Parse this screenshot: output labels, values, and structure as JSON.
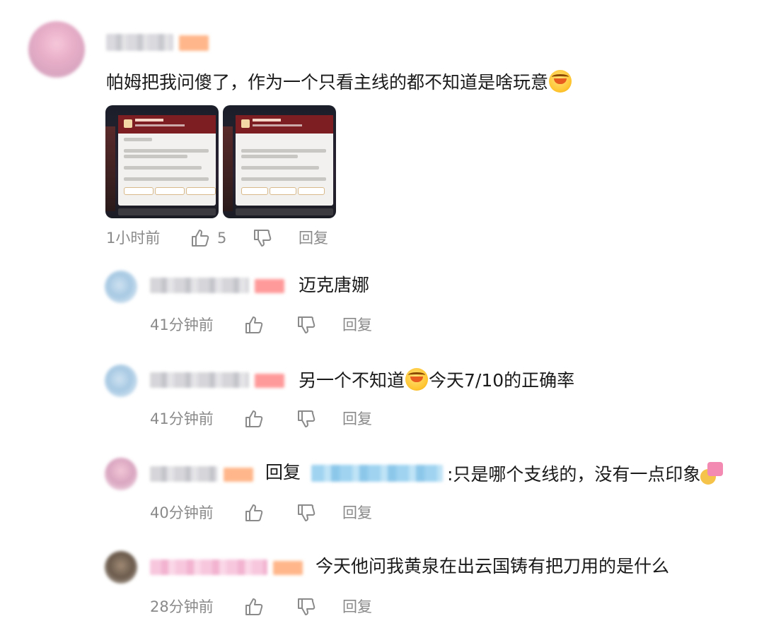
{
  "main_comment": {
    "text": "帕姆把我问傻了，作为一个只看主线的都不知道是啥玩意",
    "emoji": "crying-laughing",
    "time": "1小时前",
    "like_count": "5",
    "reply_label": "回复",
    "images": 2
  },
  "replies": [
    {
      "text": "迈克唐娜",
      "time": "41分钟前",
      "reply_label": "回复"
    },
    {
      "text_before_emoji": "另一个不知道",
      "text_after_emoji": "今天7/10的正确率",
      "time": "41分钟前",
      "reply_label": "回复"
    },
    {
      "prefix": "回复",
      "text": ":只是哪个支线的，没有一点印象",
      "time": "40分钟前",
      "reply_label": "回复"
    },
    {
      "text": "今天他问我黄泉在出云国铸有把刀用的是什么",
      "time": "28分钟前",
      "reply_label": "回复"
    }
  ],
  "colors": {
    "meta_gray": "#8a8a8a",
    "text": "#1a1a1a",
    "badge_orange": "#ffb68a",
    "badge_red": "#ff9a9a"
  }
}
